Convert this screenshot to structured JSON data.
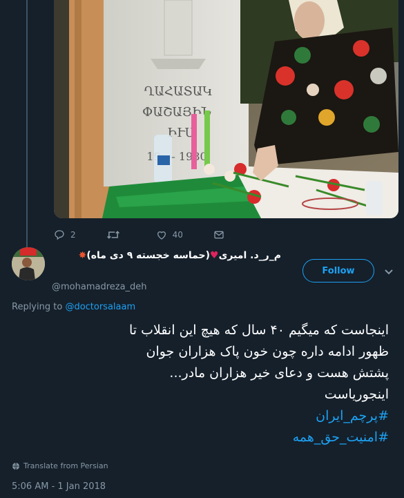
{
  "parent_tweet": {
    "actions": {
      "reply_count": "2",
      "retweet_count": "",
      "like_count": "40"
    },
    "media_gravestone_text": [
      "ՂԱՀԱՏԱԿ",
      "ՓԱՇԱՅԻՆ",
      "ԻՒՍ",
      "19 — 1980"
    ]
  },
  "reply": {
    "display_name": "م_ر_د. امیری",
    "display_name_suffix": "(حماسه خجسته ۹ دی ماه)",
    "handle": "@mohamadreza_deh",
    "follow_label": "Follow",
    "replying_prefix": "Replying to",
    "replying_mention": "@doctorsalaam",
    "text_lines": [
      "اینجاست که میگیم ۴۰ سال که هیچ این انقلاب تا",
      "ظهور ادامه داره چون خون پاک هزاران جوان",
      "پشتش هست و دعای خیر هزاران مادر...",
      "اینجوریاست"
    ],
    "hashtags": [
      "#پرچم_ایران",
      "#امنیت_حق_همه"
    ],
    "translate_label": "Translate from Persian",
    "timestamp": "5:06 AM - 1 Jan 2018"
  },
  "colors": {
    "background": "#15202b",
    "accent": "#1da1f2",
    "muted": "#8899a6",
    "heart": "#e0245e"
  }
}
